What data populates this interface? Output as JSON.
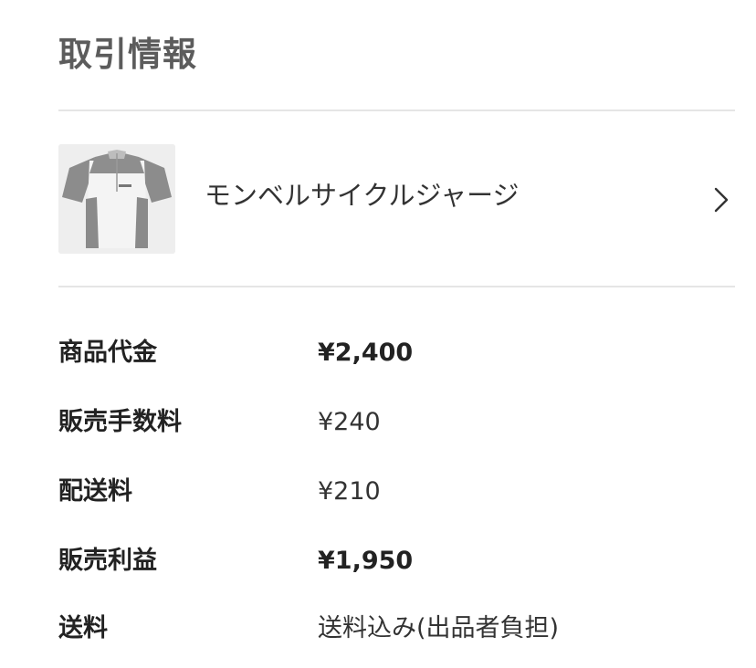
{
  "section": {
    "title": "取引情報"
  },
  "item": {
    "name": "モンベルサイクルジャージ",
    "thumbnail_icon": "cycling-jersey-photo",
    "chevron_icon": "chevron-right-icon"
  },
  "details": [
    {
      "label": "商品代金",
      "value": "¥2,400",
      "emphasis": true
    },
    {
      "label": "販売手数料",
      "value": "¥240",
      "emphasis": false
    },
    {
      "label": "配送料",
      "value": "¥210",
      "emphasis": false
    },
    {
      "label": "販売利益",
      "value": "¥1,950",
      "emphasis": true
    },
    {
      "label": "送料",
      "value": "送料込み(出品者負担)",
      "emphasis": false
    }
  ],
  "colors": {
    "title": "#5c5c5c",
    "divider": "#e5e5e5",
    "text": "#333333",
    "label": "#222222"
  }
}
